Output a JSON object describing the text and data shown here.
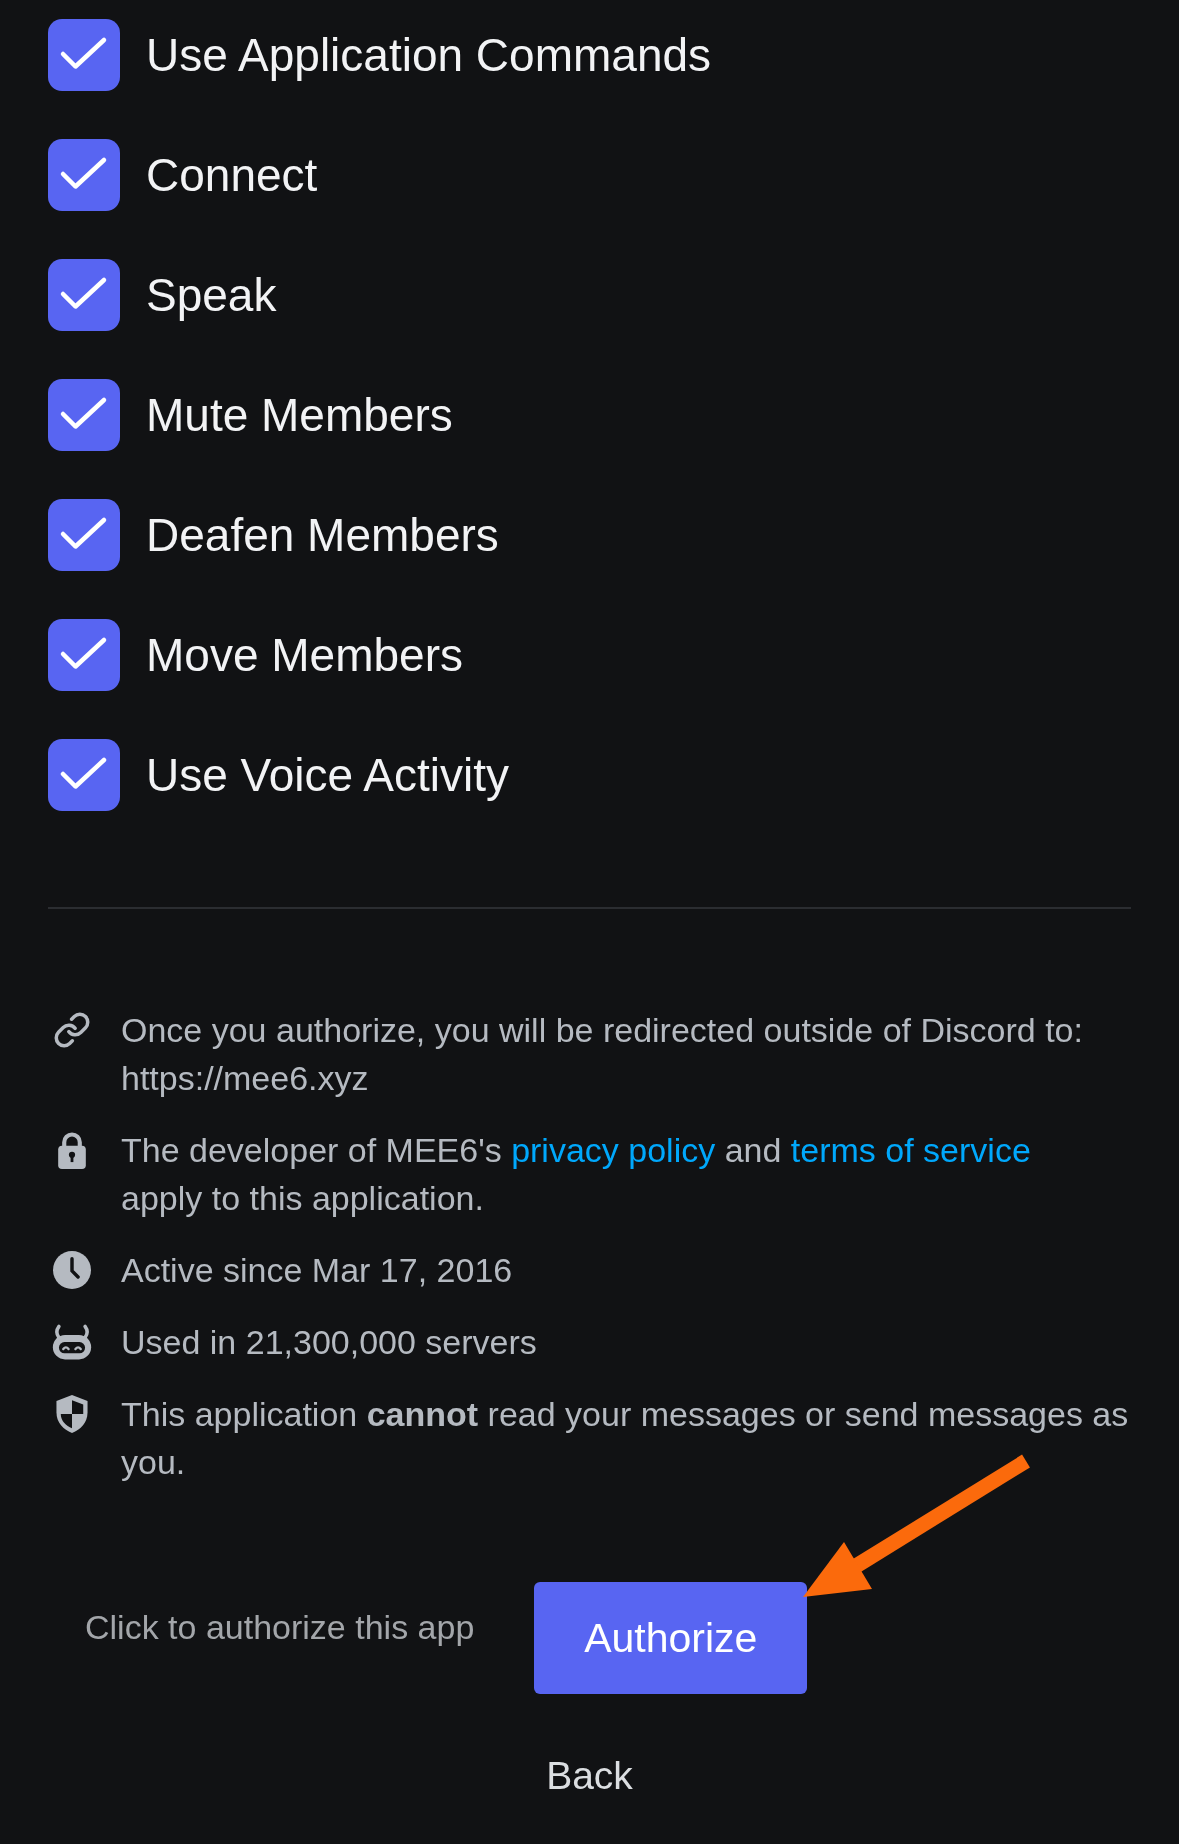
{
  "permissions": [
    {
      "label": "Use Application Commands",
      "checked": true
    },
    {
      "label": "Connect",
      "checked": true
    },
    {
      "label": "Speak",
      "checked": true
    },
    {
      "label": "Mute Members",
      "checked": true
    },
    {
      "label": "Deafen Members",
      "checked": true
    },
    {
      "label": "Move Members",
      "checked": true
    },
    {
      "label": "Use Voice Activity",
      "checked": true
    }
  ],
  "notices": [
    {
      "kind": "redirect",
      "text": "Once you authorize, you will be redirected outside of Discord to: https://mee6.xyz"
    },
    {
      "kind": "policy",
      "segments": [
        {
          "kind": "text",
          "text": "The developer of MEE6's "
        },
        {
          "kind": "link",
          "text": "privacy policy"
        },
        {
          "kind": "text",
          "text": " and "
        },
        {
          "kind": "link",
          "text": "terms of service"
        },
        {
          "kind": "text",
          "text": " apply to this application."
        }
      ]
    },
    {
      "kind": "age",
      "text": "Active since Mar 17, 2016"
    },
    {
      "kind": "usage",
      "text": "Used in 21,300,000 servers"
    },
    {
      "kind": "privacy",
      "text": "This application **cannot** read your messages or send messages as you."
    }
  ],
  "hint": "Click to authorize this app",
  "buttons": {
    "authorize": "Authorize",
    "back": "Back"
  }
}
